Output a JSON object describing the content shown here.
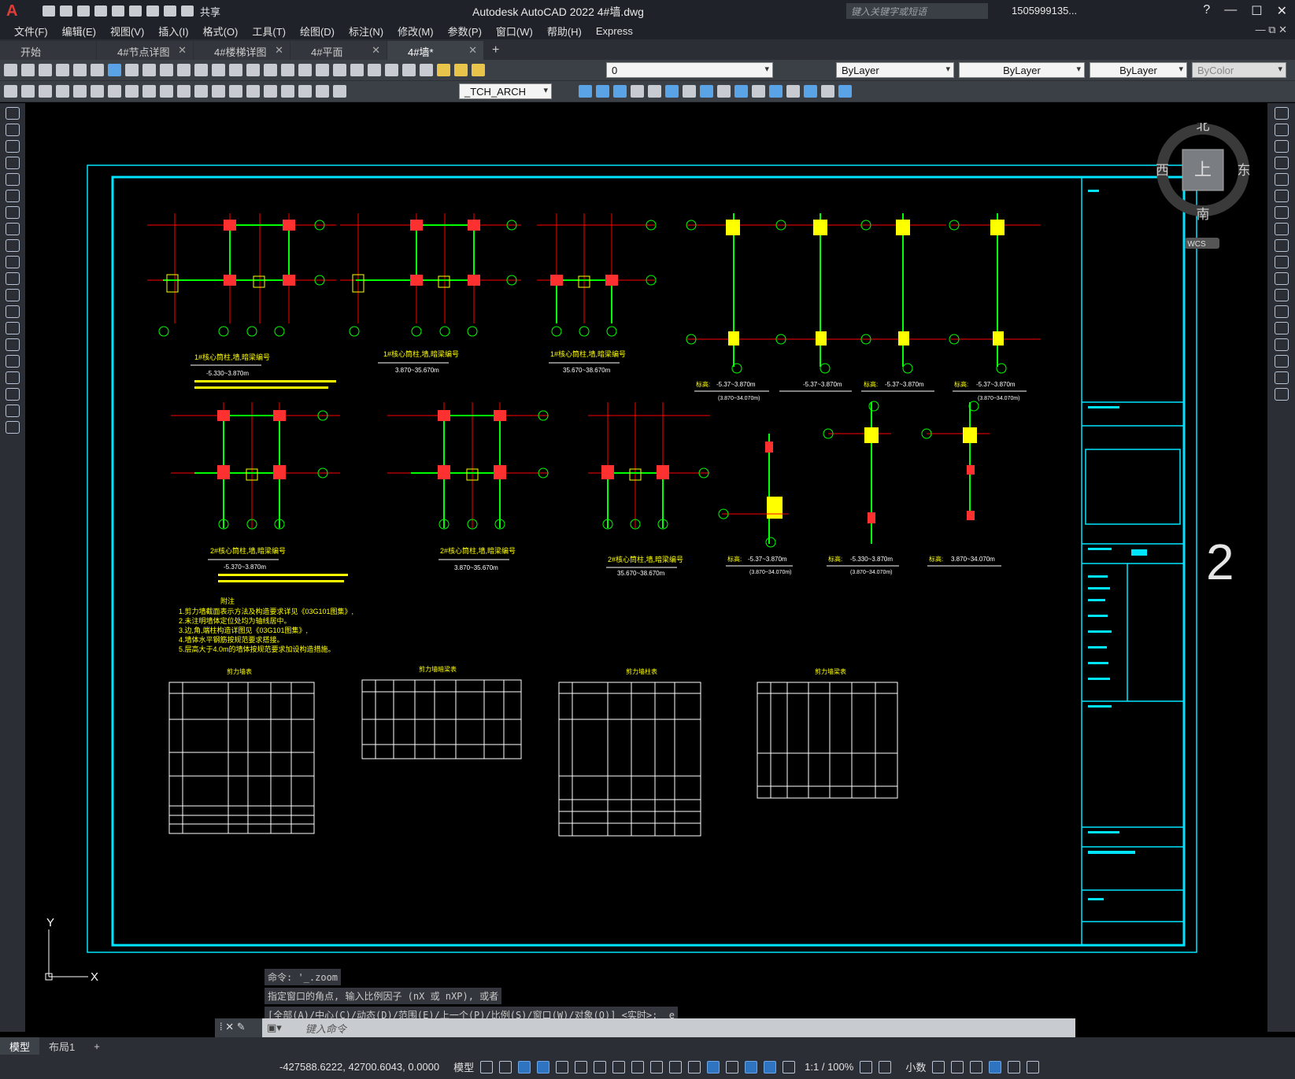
{
  "window": {
    "title": "Autodesk AutoCAD 2022    4#墙.dwg",
    "logo": "A",
    "share": "共享",
    "search_placeholder": "键入关键字或短语",
    "user": "1505999135...",
    "help": "?"
  },
  "menu": {
    "items": [
      "文件(F)",
      "编辑(E)",
      "视图(V)",
      "插入(I)",
      "格式(O)",
      "工具(T)",
      "绘图(D)",
      "标注(N)",
      "修改(M)",
      "参数(P)",
      "窗口(W)",
      "帮助(H)",
      "Express"
    ]
  },
  "tabs": {
    "items": [
      "开始",
      "4#节点详图",
      "4#楼梯详图",
      "4#平面",
      "4#墙*"
    ],
    "active_index": 4
  },
  "toolbar": {
    "layer_value": "0",
    "color_value": "ByLayer",
    "linetype_value": "ByLayer",
    "lineweight_value": "ByLayer",
    "plotstyle_value": "ByColor",
    "textstyle_value": "_TCH_ARCH"
  },
  "viewcube": {
    "north": "北",
    "south": "南",
    "east": "东",
    "west": "西",
    "top_face": "上",
    "wcs": "WCS"
  },
  "ucs": {
    "x_label": "X",
    "y_label": "Y"
  },
  "drawing": {
    "plan_titles": [
      "1#核心筒柱,墙,暗梁编号",
      "1#核心筒柱,墙,暗梁编号",
      "1#核心筒柱,墙,暗梁编号",
      "2#核心筒柱,墙,暗梁编号",
      "2#核心筒柱,墙,暗梁编号",
      "2#核心筒柱,墙,暗梁编号"
    ],
    "plan_elevations": [
      "-5.330~3.870m",
      "3.870~35.670m",
      "35.670~38.670m",
      "-5.370~3.870m",
      "3.870~35.670m",
      "35.670~38.670m"
    ],
    "column_elevations": [
      "-5.37~3.870m",
      "-5.37~3.870m",
      "-5.37~3.870m",
      "-5.37~3.870m"
    ],
    "column_subs": [
      "(3.870~34.070m)",
      "(3.870~34.070m)"
    ],
    "small_elevations": [
      "-5.37~3.870m",
      "-5.330~3.870m",
      "3.870~34.070m"
    ],
    "small_subs": [
      "(3.870~34.070m)",
      "(3.870~34.070m)"
    ],
    "elev_label": "标高:",
    "notes_title": "附注",
    "notes": [
      "1.剪力墙截面表示方法及构造要求详见《03G101图集》,",
      "2.未注明墙体定位处均为轴线居中。",
      "3.边,角,端柱构造详图见《03G101图集》,",
      "4.墙体水平钢筋按规范要求搭接。",
      "5.层高大于4.0m的墙体按规范要求加设构造措施。"
    ],
    "table_titles": [
      "剪力墙表",
      "剪力墙暗梁表",
      "剪力墙柱表",
      "剪力墙梁表"
    ],
    "big_number": "2"
  },
  "command": {
    "history": [
      "命令: '_.zoom",
      "指定窗口的角点, 输入比例因子 (nX 或 nXP), 或者",
      "[全部(A)/中心(C)/动态(D)/范围(E)/上一个(P)/比例(S)/窗口(W)/对象(O)] <实时>: _e"
    ],
    "placeholder": "键入命令"
  },
  "layout_tabs": [
    "模型",
    "布局1"
  ],
  "status": {
    "coords": "-427588.6222, 42700.6043, 0.0000",
    "space": "模型",
    "scale": "1:1 / 100%",
    "units": "小数"
  },
  "colors": {
    "frame": "#00e5ff",
    "axis": "#ff0000",
    "wall": "#00ff00",
    "label": "#ffff00",
    "table": "#ffffff"
  }
}
